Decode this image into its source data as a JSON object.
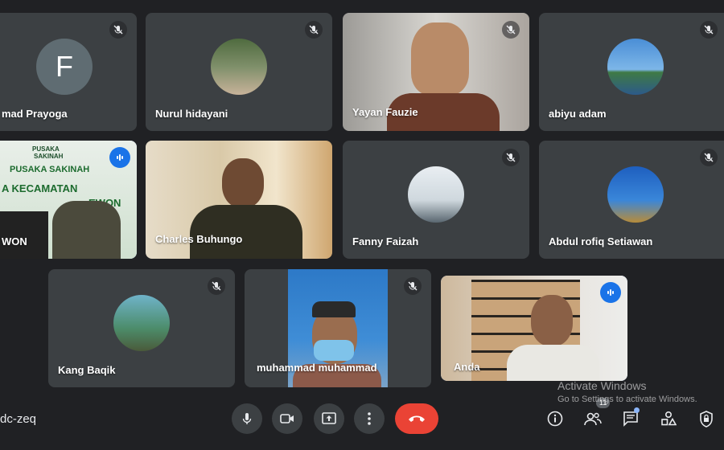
{
  "meeting": {
    "code": "dc-zeq"
  },
  "participants": [
    {
      "name": "mad Prayoga",
      "muted": true,
      "avatar_letter": "F"
    },
    {
      "name": "Nurul hidayani",
      "muted": true
    },
    {
      "name": "Yayan Fauzie",
      "muted": true
    },
    {
      "name": "abiyu adam",
      "muted": true
    },
    {
      "name": "WON",
      "speaking": true,
      "banner_line1": "PUSAKA",
      "banner_line2": "SAKINAH",
      "banner_line3": "PUSAKA SAKINAH",
      "banner_line4": "A KECAMATAN",
      "banner_line5": "EWON"
    },
    {
      "name": "Charles Buhungo"
    },
    {
      "name": "Fanny Faizah",
      "muted": true
    },
    {
      "name": "Abdul rofiq Setiawan",
      "muted": true
    },
    {
      "name": "Kang Baqik",
      "muted": true
    },
    {
      "name": "muhammad muhammad",
      "muted": true
    },
    {
      "name": "Anda",
      "speaking": true
    }
  ],
  "controls": {
    "people_count": "11",
    "icons": [
      "microphone-icon",
      "camera-icon",
      "present-icon",
      "more-icon",
      "end-call-icon",
      "info-icon",
      "people-icon",
      "chat-icon",
      "activities-icon",
      "host-controls-icon"
    ]
  },
  "watermark": {
    "title": "Activate Windows",
    "subtitle": "Go to Settings to activate Windows."
  },
  "colors": {
    "background": "#202124",
    "tile": "#3c4043",
    "accent": "#1a73e8",
    "end_call": "#ea4335"
  }
}
